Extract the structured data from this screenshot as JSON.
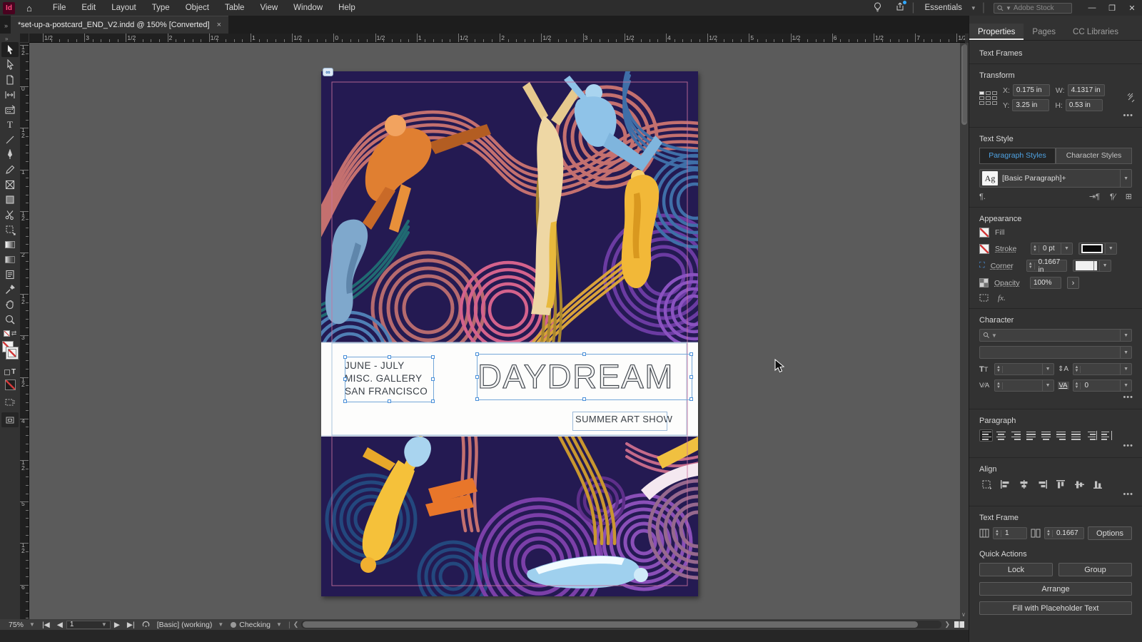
{
  "menubar": {
    "logo": "Id",
    "menus": [
      "File",
      "Edit",
      "Layout",
      "Type",
      "Object",
      "Table",
      "View",
      "Window",
      "Help"
    ],
    "workspace": "Essentials",
    "search_placeholder": "Adobe Stock"
  },
  "document_tab": {
    "title": "*set-up-a-postcard_END_V2.indd @ 150% [Converted]",
    "close": "×"
  },
  "rulers": {
    "horizontal_labels": [
      "1/2",
      "3",
      "1/2",
      "2",
      "1/2",
      "1",
      "1/2",
      "0",
      "1/2",
      "1",
      "1/2",
      "2",
      "1/2",
      "3",
      "1/2",
      "4",
      "1/2",
      "5",
      "1/2",
      "6",
      "1/2",
      "7",
      "1/2"
    ],
    "vertical_labels": [
      "1/2",
      "0",
      "1/2",
      "1",
      "1/2",
      "2",
      "1/2",
      "3",
      "1/2",
      "4",
      "1/2",
      "5",
      "1/2",
      "6"
    ]
  },
  "toolbar": {
    "tools": [
      {
        "name": "selection-tool",
        "icon": "select",
        "active": true
      },
      {
        "name": "direct-selection-tool",
        "icon": "direct",
        "active": false
      },
      {
        "name": "page-tool",
        "icon": "page",
        "active": false
      },
      {
        "name": "gap-tool",
        "icon": "gap",
        "active": false
      },
      {
        "name": "content-collector-tool",
        "icon": "collector",
        "active": false
      },
      {
        "name": "type-tool",
        "icon": "type",
        "active": false
      },
      {
        "name": "line-tool",
        "icon": "line",
        "active": false
      },
      {
        "name": "pen-tool",
        "icon": "pen",
        "active": false
      },
      {
        "name": "pencil-tool",
        "icon": "pencil",
        "active": false
      },
      {
        "name": "frame-tool",
        "icon": "frame",
        "active": false
      },
      {
        "name": "rectangle-tool",
        "icon": "rect",
        "active": false
      },
      {
        "name": "scissors-tool",
        "icon": "scissors",
        "active": false
      },
      {
        "name": "free-transform-tool",
        "icon": "freetransform",
        "active": false
      },
      {
        "name": "gradient-swatch-tool",
        "icon": "gradient",
        "active": false
      },
      {
        "name": "gradient-feather-tool",
        "icon": "feather",
        "active": false
      },
      {
        "name": "note-tool",
        "icon": "note",
        "active": false
      },
      {
        "name": "eyedropper-tool",
        "icon": "eyedropper",
        "active": false
      },
      {
        "name": "hand-tool",
        "icon": "hand",
        "active": false
      },
      {
        "name": "zoom-tool",
        "icon": "zoom",
        "active": false
      }
    ]
  },
  "postcard": {
    "dates": "JUNE - JULY",
    "gallery": "MISC. GALLERY",
    "city": "SAN FRANCISCO",
    "title": "DAYDREAM",
    "subtitle": "SUMMER ART SHOW",
    "colors": {
      "background": "#241a52",
      "salmon": "#c4706f",
      "pink": "#d4628c",
      "purple": "#7b3fa8",
      "blue": "#3f6fa8",
      "gold": "#d9a33a",
      "teal": "#206a72",
      "text": "#3a4047"
    }
  },
  "properties_panel": {
    "tabs": [
      "Properties",
      "Pages",
      "CC Libraries"
    ],
    "selection_type": "Text Frames",
    "transform": {
      "title": "Transform",
      "x_label": "X:",
      "x": "0.175 in",
      "y_label": "Y:",
      "y": "3.25 in",
      "w_label": "W:",
      "w": "4.1317 in",
      "h_label": "H:",
      "h": "0.53 in"
    },
    "text_style": {
      "title": "Text Style",
      "paragraph_tab": "Paragraph Styles",
      "character_tab": "Character Styles",
      "style_thumb": "Ag",
      "style_name": "[Basic Paragraph]+",
      "pilcrow": "¶."
    },
    "appearance": {
      "title": "Appearance",
      "fill_label": "Fill",
      "stroke_label": "Stroke",
      "stroke_weight": "0 pt",
      "corner_label": "Corner",
      "corner_radius": "0.1667 in",
      "opacity_label": "Opacity",
      "opacity": "100%",
      "fx_label": "fx."
    },
    "character": {
      "title": "Character",
      "tracking": "0"
    },
    "paragraph": {
      "title": "Paragraph"
    },
    "align": {
      "title": "Align"
    },
    "text_frame": {
      "title": "Text Frame",
      "columns": "1",
      "inset": "0.1667",
      "options_button": "Options"
    },
    "quick_actions": {
      "title": "Quick Actions",
      "lock": "Lock",
      "group": "Group",
      "arrange": "Arrange",
      "fill_placeholder": "Fill with Placeholder Text"
    }
  },
  "status_bar": {
    "zoom": "75%",
    "page": "1",
    "preflight_preset": "[Basic] (working)",
    "preflight_status": "Checking"
  }
}
